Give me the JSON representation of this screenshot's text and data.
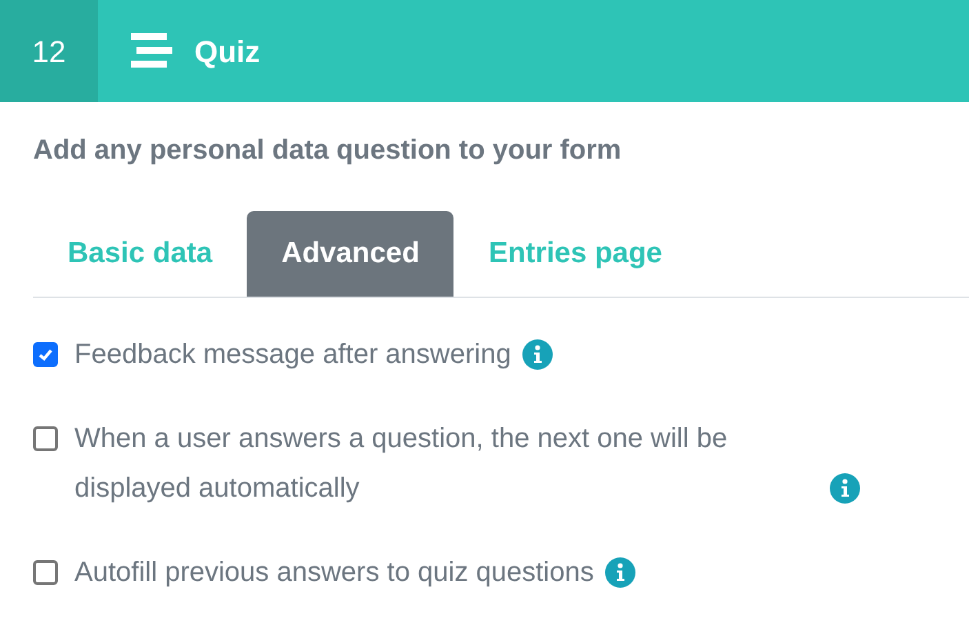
{
  "header": {
    "number": "12",
    "title": "Quiz"
  },
  "intro": "Add any personal data question to your form",
  "tabs": [
    {
      "label": "Basic data",
      "selected": false
    },
    {
      "label": "Advanced",
      "selected": true
    },
    {
      "label": "Entries page",
      "selected": false
    }
  ],
  "options": [
    {
      "label": "Feedback message after answering",
      "checked": true
    },
    {
      "label": "When a user answers a question, the next one will be displayed automatically",
      "checked": false
    },
    {
      "label": "Autofill previous answers to quiz questions",
      "checked": false
    }
  ]
}
